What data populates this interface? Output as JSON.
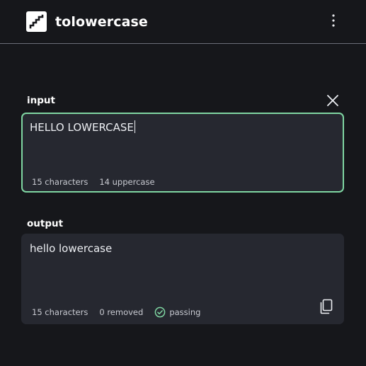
{
  "header": {
    "app_title": "tolowercase",
    "logo_icon": "stairs-icon",
    "menu_icon": "more-vertical-icon"
  },
  "input": {
    "label": "input",
    "value": "HELLO LOWERCASE",
    "char_count": "15 characters",
    "uppercase_count": "14 uppercase",
    "clear_icon": "close-icon",
    "accent_color": "#7fd6a2"
  },
  "output": {
    "label": "output",
    "value": "hello lowercase",
    "char_count": "15 characters",
    "removed_count": "0 removed",
    "status_label": "passing",
    "status_icon": "check-circle-icon",
    "status_color": "#7fd6a2",
    "copy_icon": "copy-icon"
  },
  "colors": {
    "background": "#16171b",
    "panel": "#262830",
    "text": "#eceef2"
  }
}
